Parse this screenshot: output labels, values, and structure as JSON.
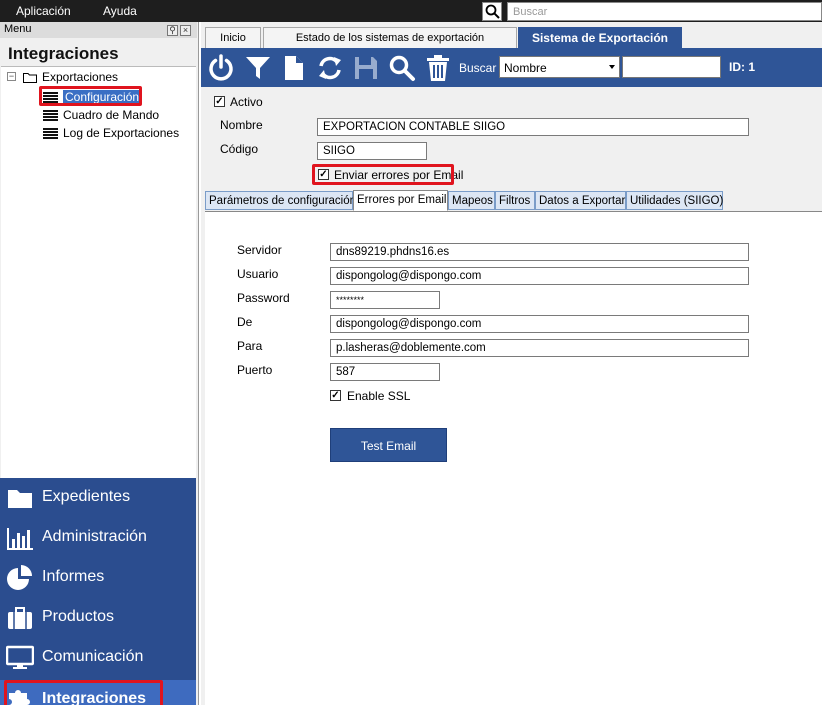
{
  "menubar": {
    "items": [
      "Aplicación",
      "Ayuda"
    ],
    "search_placeholder": "Buscar"
  },
  "left": {
    "caption": "Menu",
    "title": "Integraciones",
    "tree": {
      "root": "Exportaciones",
      "children": [
        "Configuración",
        "Cuadro de Mando",
        "Log de Exportaciones"
      ]
    },
    "nav": [
      "Expedientes",
      "Administración",
      "Informes",
      "Productos",
      "Comunicación",
      "Integraciones"
    ]
  },
  "tabs": [
    "Inicio",
    "Estado de los sistemas de exportación",
    "Sistema de Exportación"
  ],
  "toolbar": {
    "search_label": "Buscar",
    "search_field": "Nombre",
    "search_value": "",
    "id_label": "ID: 1"
  },
  "form": {
    "activo_label": "Activo",
    "activo_checked": true,
    "nombre_label": "Nombre",
    "nombre_value": "EXPORTACION CONTABLE SIIGO",
    "codigo_label": "Código",
    "codigo_value": "SIIGO",
    "enviar_label": "Enviar errores por Email",
    "enviar_checked": true
  },
  "subtabs": [
    "Parámetros de configuración",
    "Errores por Email",
    "Mapeos",
    "Filtros",
    "Datos a Exportar",
    "Utilidades (SIIGO)"
  ],
  "email": {
    "servidor_label": "Servidor",
    "servidor_value": "dns89219.phdns16.es",
    "usuario_label": "Usuario",
    "usuario_value": "dispongolog@dispongo.com",
    "password_label": "Password",
    "password_value": "********",
    "de_label": "De",
    "de_value": "dispongolog@dispongo.com",
    "para_label": "Para",
    "para_value": "p.lasheras@doblemente.com",
    "puerto_label": "Puerto",
    "puerto_value": "587",
    "ssl_label": "Enable SSL",
    "ssl_checked": true,
    "test_button": "Test Email"
  },
  "colors": {
    "brand_blue": "#2f5597",
    "nav_active": "#3e6bbf",
    "highlight_red": "#e0141e"
  }
}
